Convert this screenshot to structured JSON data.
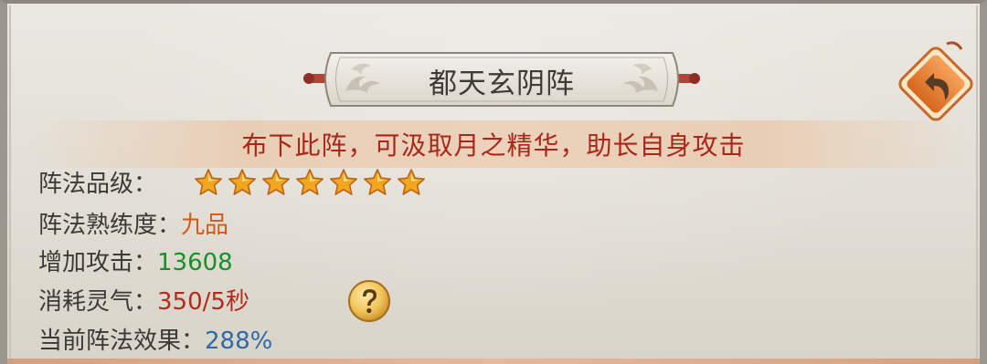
{
  "formation": {
    "title": "都天玄阴阵",
    "description": "布下此阵，可汲取月之精华，助长自身攻击"
  },
  "stats": {
    "grade": {
      "label": "阵法品级：",
      "stars": 7,
      "star_max": 7
    },
    "proficiency": {
      "label": "阵法熟练度：",
      "value": "九品"
    },
    "attack_bonus": {
      "label": "增加攻击：",
      "value": "13608"
    },
    "spirit_cost": {
      "label": "消耗灵气：",
      "value": "350/5秒"
    },
    "current_effect": {
      "label": "当前阵法效果：",
      "value": "288%"
    }
  },
  "icons": {
    "back": "back-arrow-icon",
    "help": "question-mark-icon",
    "star": "star-icon"
  },
  "colors": {
    "description_red": "#a8261a",
    "proficiency_orange": "#d35a12",
    "attack_green": "#17902a",
    "cost_red": "#b42a1b",
    "effect_blue": "#2e6aa6",
    "star_gold": "#f2a51d",
    "back_button_orange": "#e07a2c"
  }
}
